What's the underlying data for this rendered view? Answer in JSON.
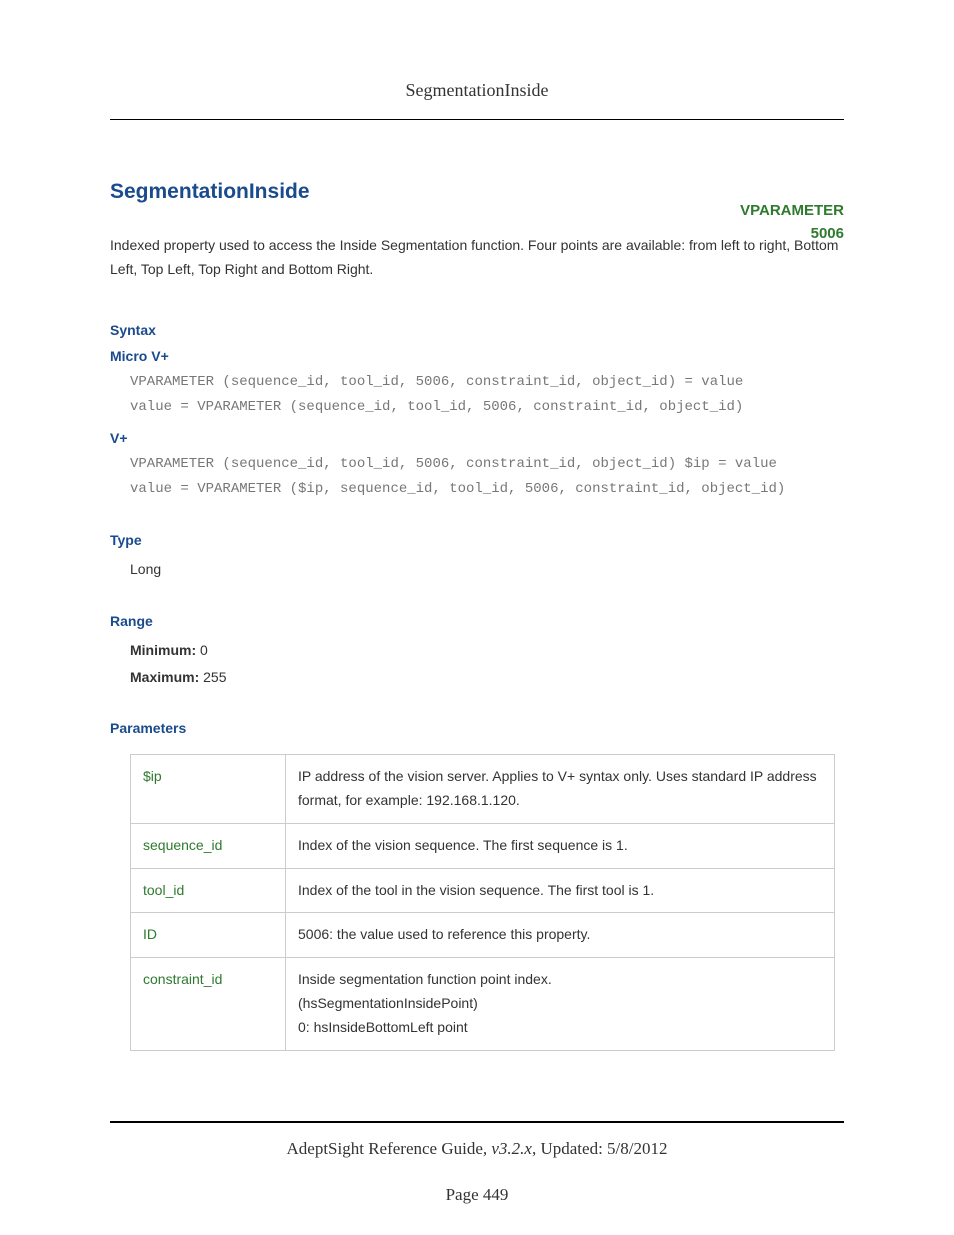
{
  "running_header": "SegmentationInside",
  "title": "SegmentationInside",
  "badge": {
    "line1": "VPARAMETER",
    "line2": "5006"
  },
  "intro": "Indexed property used to access the Inside Segmentation function. Four points are available: from left to right, Bottom Left, Top Left, Top Right and Bottom Right.",
  "sections": {
    "syntax_label": "Syntax",
    "microv_label": "Micro V+",
    "microv_code": "VPARAMETER (sequence_id, tool_id, 5006, constraint_id, object_id) = value\nvalue = VPARAMETER (sequence_id, tool_id, 5006, constraint_id, object_id)",
    "vplus_label": "V+",
    "vplus_code": "VPARAMETER (sequence_id, tool_id, 5006, constraint_id, object_id) $ip = value\nvalue = VPARAMETER ($ip, sequence_id, tool_id, 5006, constraint_id, object_id)",
    "type_label": "Type",
    "type_value": "Long",
    "range_label": "Range",
    "min_label": "Minimum:",
    "min_value": "0",
    "max_label": "Maximum:",
    "max_value": "255",
    "parameters_label": "Parameters"
  },
  "params": [
    {
      "name": "$ip",
      "desc": "IP address of the vision server. Applies to V+ syntax only. Uses standard IP address format, for example: 192.168.1.120."
    },
    {
      "name": "sequence_id",
      "desc": "Index of the vision sequence. The first sequence is 1."
    },
    {
      "name": "tool_id",
      "desc": "Index of the tool in the vision sequence. The first tool is 1."
    },
    {
      "name": "ID",
      "desc": "5006: the value used to reference this property."
    },
    {
      "name": "constraint_id",
      "desc": "Inside segmentation function point index.\n(hsSegmentationInsidePoint)\n0: hsInsideBottomLeft point"
    }
  ],
  "footer": {
    "guide": "AdeptSight Reference Guide",
    "version": ", v3.2.x",
    "updated": ", Updated: 5/8/2012",
    "page": "Page 449"
  }
}
